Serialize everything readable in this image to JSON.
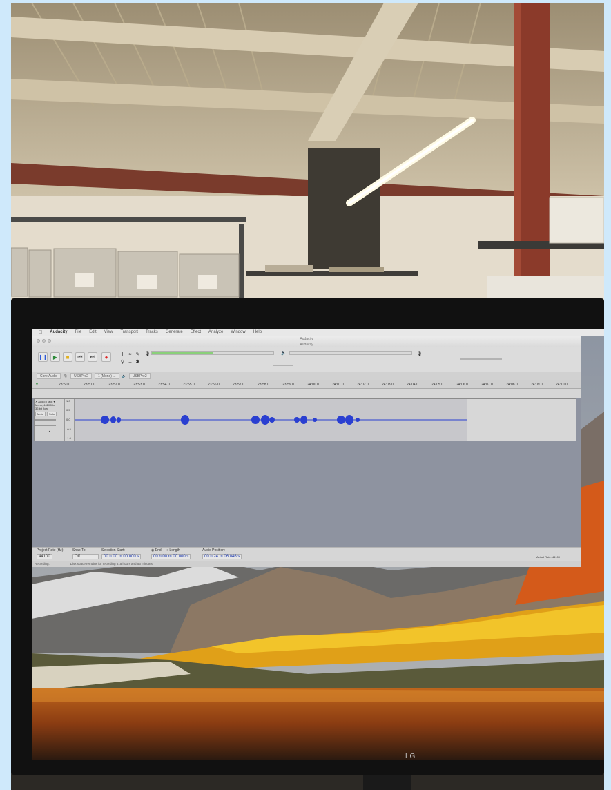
{
  "menubar": {
    "app": "Audacity",
    "items": [
      "File",
      "Edit",
      "View",
      "Transport",
      "Tracks",
      "Generate",
      "Effect",
      "Analyze",
      "Window",
      "Help"
    ]
  },
  "window": {
    "title": "Audacity",
    "subtitle": "Audacity"
  },
  "devices": {
    "host": "Core Audio",
    "recording": "USBPre2",
    "channels": "1 (Mono) ...",
    "playback": "USBPre2"
  },
  "ruler": {
    "ticks": [
      "23:50.0",
      "23:51.0",
      "23:52.0",
      "23:53.0",
      "23:54.0",
      "23:55.0",
      "23:56.0",
      "23:57.0",
      "23:58.0",
      "23:59.0",
      "24:00.0",
      "24:01.0",
      "24:02.0",
      "24:03.0",
      "24:04.0",
      "24:05.0",
      "24:06.0",
      "24:07.0",
      "24:08.0",
      "24:09.0",
      "24:10.0"
    ]
  },
  "track": {
    "name": "Audio Track",
    "info1": "Mono, 44100Hz",
    "info2": "32-bit float",
    "mute": "Mute",
    "solo": "Solo",
    "scale": [
      "1.0",
      "0.5",
      "0.0",
      "-0.5",
      "-1.0"
    ]
  },
  "selection": {
    "project_rate_label": "Project Rate (Hz):",
    "project_rate": "44100",
    "snap_label": "Snap To:",
    "snap": "Off",
    "start_label": "Selection Start:",
    "start": "00 h 00 m 00.000 s",
    "end_label": "End",
    "length_label": "Length",
    "end": "00 h 00 m 00.000 s",
    "pos_label": "Audio Position:",
    "pos": "00 h 24 m 06.046 s",
    "actual_rate": "Actual Rate: 44100"
  },
  "status": {
    "state": "Recording.",
    "message": "Disk space remains for recording 615 hours and 53 minutes."
  },
  "monitor": {
    "brand": "LG"
  },
  "colors": {
    "waveform": "#2a3fd1",
    "meter_green": "#8ad07a",
    "selection_text": "#1a37ad"
  }
}
